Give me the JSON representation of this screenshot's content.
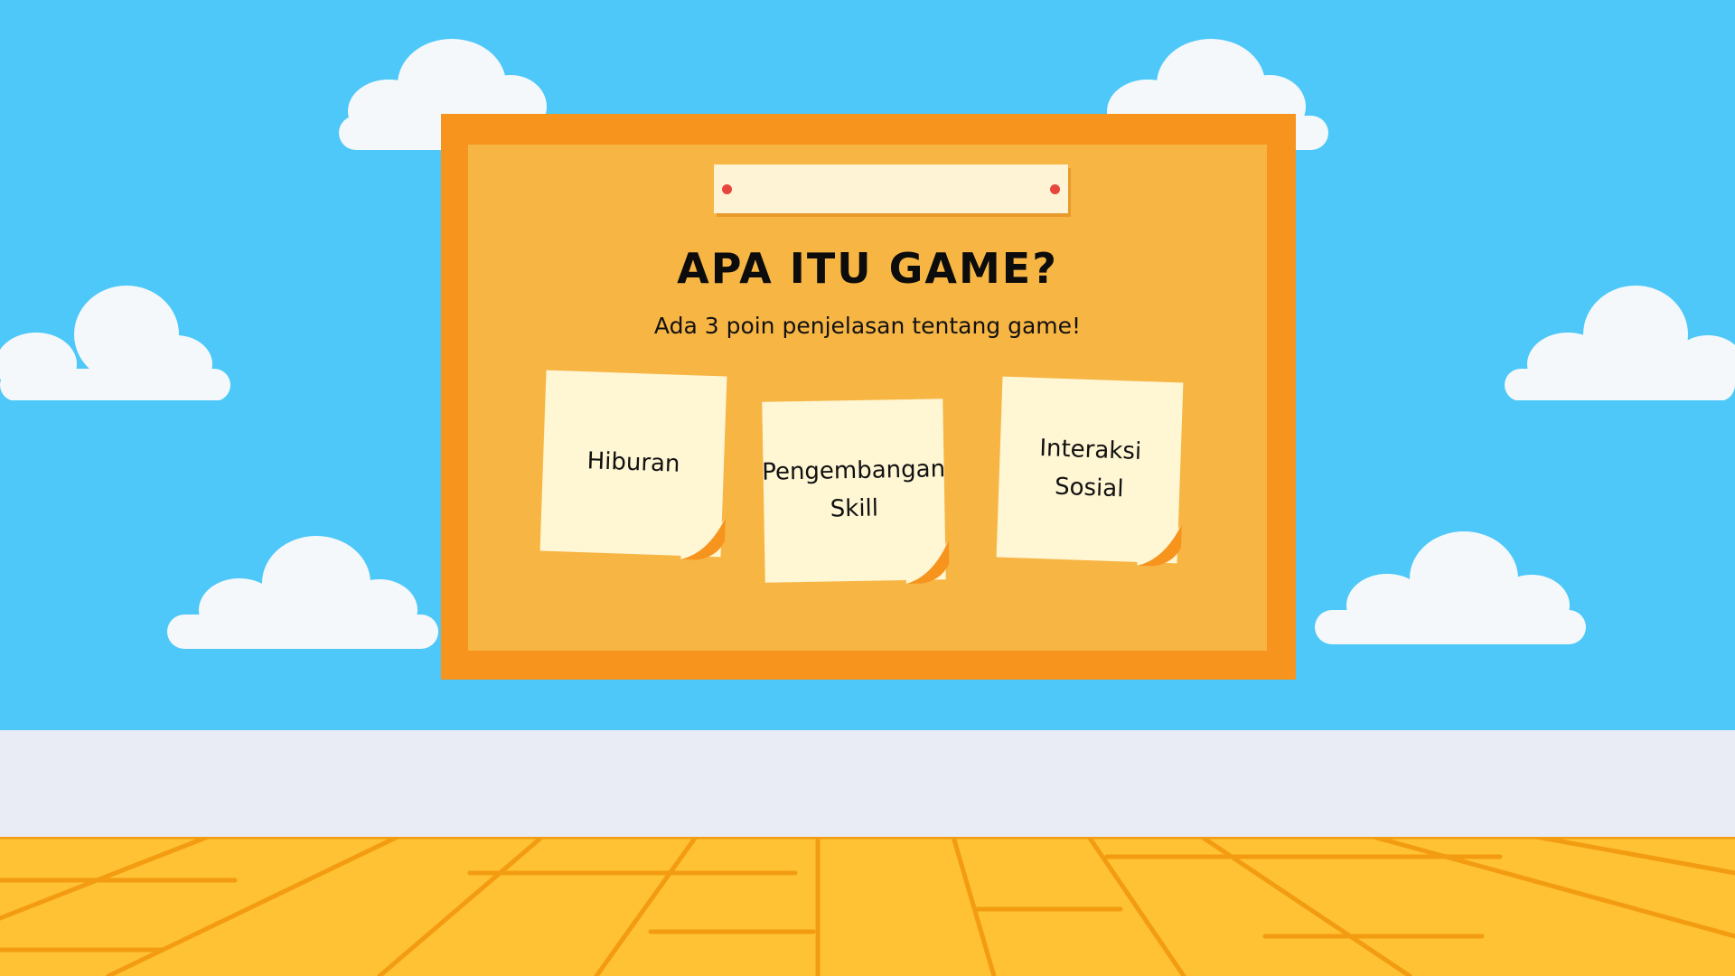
{
  "board": {
    "title": "APA ITU GAME?",
    "subtitle": "Ada 3 poin penjelasan tentang game!"
  },
  "notes": [
    {
      "text": "Hiburan"
    },
    {
      "text": "Pengembangan Skill"
    },
    {
      "text": "Interaksi Sosial"
    }
  ],
  "colors": {
    "sky": "#4dc8f8",
    "board_frame": "#f7941d",
    "board_inner": "#f7b544",
    "note": "#fff6d4",
    "floor": "#ffc234"
  }
}
